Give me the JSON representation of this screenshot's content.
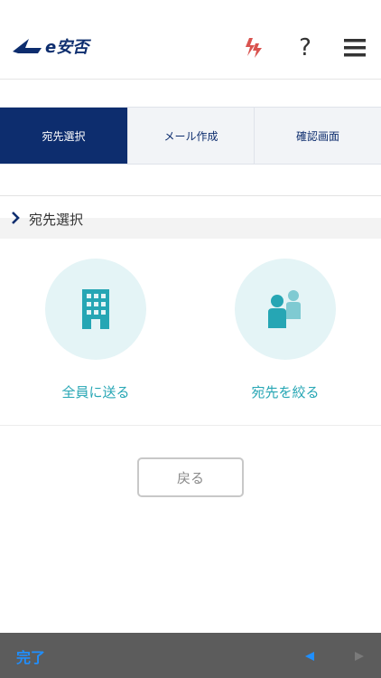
{
  "header": {
    "logo_text": "e安否",
    "help_label": "?",
    "icons": {
      "quake": "earthquake-alert-icon",
      "help": "question-icon",
      "menu": "hamburger-menu-icon"
    },
    "colors": {
      "brand": "#0d2d6e",
      "alert": "#d9534f"
    }
  },
  "steps": [
    {
      "label": "宛先選択",
      "active": true
    },
    {
      "label": "メール作成",
      "active": false
    },
    {
      "label": "確認画面",
      "active": false
    }
  ],
  "section": {
    "title": "宛先選択"
  },
  "choices": {
    "all": {
      "label": "全員に送る",
      "icon": "building-icon"
    },
    "filter": {
      "label": "宛先を絞る",
      "icon": "people-icon"
    },
    "accent": "#26a6b4"
  },
  "back_button": {
    "label": "戻る"
  },
  "toolbar": {
    "done_label": "完了"
  }
}
